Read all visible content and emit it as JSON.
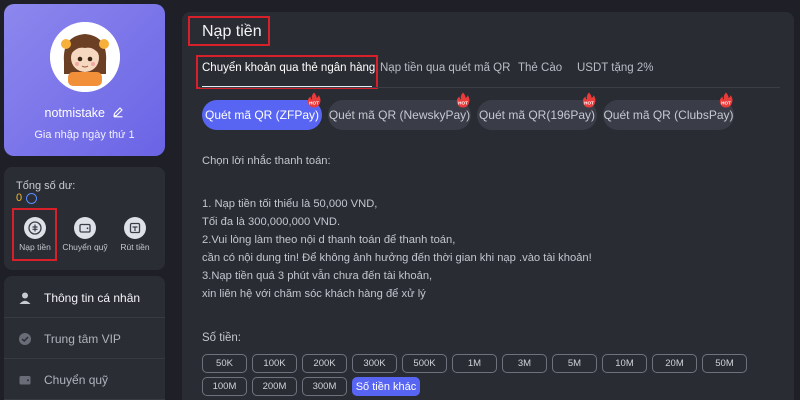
{
  "profile": {
    "username": "notmistake",
    "join_text": "Gia nhập ngày thứ 1"
  },
  "wallet": {
    "balance_label": "Tổng số dư:",
    "balance_value": "0",
    "actions": [
      {
        "label": "Nạp tiền",
        "icon": "deposit-icon"
      },
      {
        "label": "Chuyển quỹ",
        "icon": "wallet-icon"
      },
      {
        "label": "Rút tiền",
        "icon": "withdraw-icon"
      }
    ]
  },
  "menu": [
    {
      "label": "Thông tin cá nhân",
      "icon": "user-icon",
      "active": true
    },
    {
      "label": "Trung tâm VIP",
      "icon": "vip-icon",
      "active": false
    },
    {
      "label": "Chuyển quỹ",
      "icon": "wallet-icon",
      "active": false
    }
  ],
  "main": {
    "title": "Nạp tiền",
    "tabs": [
      {
        "label": "Chuyển khoản qua thẻ ngân hàng",
        "active": true
      },
      {
        "label": "Nạp tiền qua quét mã QR",
        "active": false
      },
      {
        "label": "Thẻ Cào",
        "active": false
      },
      {
        "label": "USDT tặng 2%",
        "active": false
      }
    ],
    "methods": [
      {
        "label": "Quét mã QR (ZFPay)",
        "badge": "HOT",
        "active": true
      },
      {
        "label": "Quét mã QR (NewskyPay)",
        "badge": "HOT",
        "active": false
      },
      {
        "label": "Quét mã QR(196Pay)",
        "badge": "HOT",
        "active": false
      },
      {
        "label": "Quét mã QR (ClubsPay)",
        "badge": "HOT",
        "active": false
      }
    ],
    "notes": {
      "heading": "Chọn lời nhắc thanh toán:",
      "lines": [
        "1. Nạp tiền tối thiểu là 50,000 VND,",
        "Tối đa là 300,000,000 VND.",
        "2.Vui lòng làm theo nội d thanh toán để thanh toán,",
        "cần có nội dung tin! Để không ảnh hưởng đến thời gian khi nạp .vào tài khoản!",
        "3.Nạp tiền quá 3 phút vẫn chưa đến tài khoản,",
        "xin liên hệ với chăm sóc khách hàng để xử lý"
      ]
    },
    "amount_label": "Số tiền:",
    "amounts_row1": [
      "50K",
      "100K",
      "200K",
      "300K",
      "500K",
      "1M",
      "3M",
      "5M",
      "10M",
      "20M",
      "50M"
    ],
    "amounts_row2": [
      "100M",
      "200M",
      "300M"
    ],
    "other_amount": "Số tiền khác"
  },
  "colors": {
    "accent": "#5865f2",
    "highlight": "#d8202a",
    "balance": "#f0b82f",
    "profile_bg": "#7f79ec"
  }
}
